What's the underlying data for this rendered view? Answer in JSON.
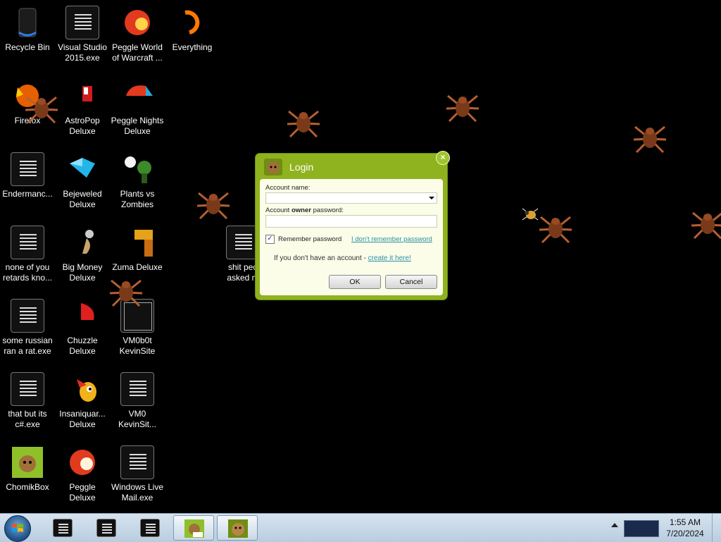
{
  "desktop": {
    "icons": [
      {
        "id": "recycle-bin",
        "label": "Recycle Bin",
        "icon": "recycle-bin-icon"
      },
      {
        "id": "visual-studio",
        "label": "Visual Studio\n2015.exe",
        "icon": "exe-icon"
      },
      {
        "id": "peggle-wow",
        "label": "Peggle World\nof Warcraft ...",
        "icon": "peggle-icon"
      },
      {
        "id": "everything",
        "label": "Everything",
        "icon": "everything-icon"
      },
      {
        "id": "firefox",
        "label": "Firefox",
        "icon": "firefox-icon"
      },
      {
        "id": "astropop",
        "label": "AstroPop\nDeluxe",
        "icon": "astropop-icon"
      },
      {
        "id": "peggle-nights",
        "label": "Peggle Nights\nDeluxe",
        "icon": "peggle-nights-icon"
      },
      {
        "id": "endermanch",
        "label": "Endermanc...",
        "icon": "exe-icon"
      },
      {
        "id": "bejeweled",
        "label": "Bejeweled\nDeluxe",
        "icon": "bejeweled-icon"
      },
      {
        "id": "pvz",
        "label": "Plants vs\nZombies",
        "icon": "plants-vs-zombies-icon"
      },
      {
        "id": "none-of-you",
        "label": "none of you\nretards kno...",
        "icon": "exe-icon"
      },
      {
        "id": "big-money",
        "label": "Big Money\nDeluxe",
        "icon": "big-money-icon"
      },
      {
        "id": "zuma",
        "label": "Zuma Deluxe",
        "icon": "zuma-icon"
      },
      {
        "id": "russian-rat",
        "label": "some russian\nran a rat.exe",
        "icon": "exe-icon"
      },
      {
        "id": "chuzzle",
        "label": "Chuzzle\nDeluxe",
        "icon": "chuzzle-icon"
      },
      {
        "id": "vm0b0t",
        "label": "VM0b0t\nKevinSite",
        "icon": "window-icon"
      },
      {
        "id": "that-but-cs",
        "label": "that but its\nc#.exe",
        "icon": "exe-icon"
      },
      {
        "id": "insaniquarium",
        "label": "Insaniquar...\nDeluxe",
        "icon": "insaniquarium-icon"
      },
      {
        "id": "vm0-kevinsite",
        "label": "VM0\nKevinSit...",
        "icon": "exe-icon"
      },
      {
        "id": "chomikbox",
        "label": "ChomikBox",
        "icon": "chomikbox-icon"
      },
      {
        "id": "peggle-deluxe",
        "label": "Peggle Deluxe",
        "icon": "peggle-icon"
      },
      {
        "id": "wl-mail",
        "label": "Windows Live\nMail.exe",
        "icon": "exe-icon"
      },
      {
        "id": "shit-people",
        "label": "shit peo\nasked m",
        "icon": "exe-icon"
      }
    ]
  },
  "dialog": {
    "title": "Login",
    "close_icon": "×",
    "account_name_label": "Account name:",
    "password_label_prefix": "Account ",
    "password_label_bold": "owner",
    "password_label_suffix": " password:",
    "account_name_value": "",
    "password_value": "",
    "remember_checked": true,
    "remember_label": "Remember password",
    "forgot_link": "I don't remember password",
    "no_account_text": "If you don't have an account - ",
    "create_link": "create it here!",
    "ok_label": "OK",
    "cancel_label": "Cancel"
  },
  "taskbar": {
    "clock_time": "1:55 AM",
    "clock_date": "7/20/2024",
    "buttons": [
      {
        "id": "tb-1",
        "icon": "exe-icon",
        "active": false
      },
      {
        "id": "tb-2",
        "icon": "exe-icon",
        "active": false
      },
      {
        "id": "tb-3",
        "icon": "exe-icon",
        "active": false
      },
      {
        "id": "tb-4",
        "icon": "chomikbox-icon",
        "active": true
      },
      {
        "id": "tb-5",
        "icon": "hamster-icon",
        "active": true
      }
    ]
  },
  "colors": {
    "dialog_green": "#8fb21f",
    "panel_bg": "#fbfde9",
    "link": "#2a8fa5",
    "desktop_bg": "#000000"
  }
}
